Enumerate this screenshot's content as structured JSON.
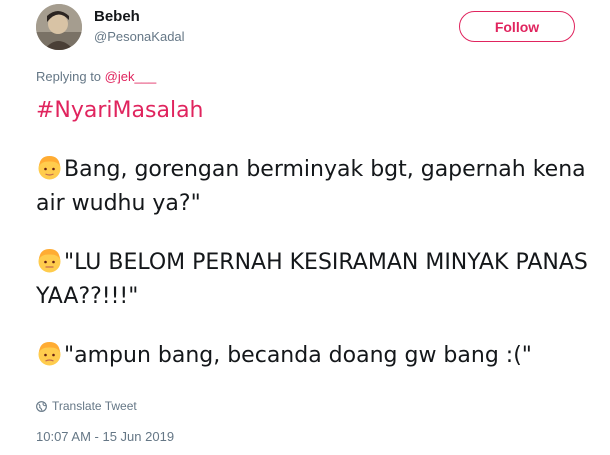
{
  "tweet": {
    "author": {
      "display_name": "Bebeh",
      "username": "@PesonaKadal",
      "avatar_icon": "avatar-photo"
    },
    "follow_label": "Follow",
    "reply": {
      "prefix": "Replying to",
      "mention": "@jek___"
    },
    "hashtag": "#NyariMasalah",
    "lines": [
      "Bang, gorengan berminyak bgt, gapernah kena air wudhu ya?\"",
      "\"LU BELOM PERNAH KESIRAMAN MINYAK PANAS YAA??!!!\"",
      "\"ampun bang, becanda doang gw bang :(\""
    ],
    "translate_label": "Translate Tweet",
    "timestamp": "10:07 AM - 15 Jun 2019",
    "colors": {
      "accent": "#e0245e",
      "muted": "#657786",
      "text": "#14171a"
    }
  }
}
